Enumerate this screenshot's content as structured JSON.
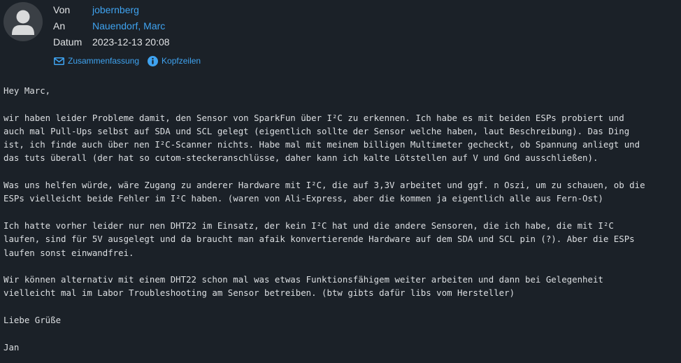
{
  "header": {
    "from_label": "Von",
    "from_value": "jobernberg",
    "to_label": "An",
    "to_value": "Nauendorf, Marc",
    "date_label": "Datum",
    "date_value": "2023-12-13 20:08"
  },
  "actions": {
    "summary_label": "Zusammenfassung",
    "headers_label": "Kopfzeilen"
  },
  "icons": {
    "avatar": "person-silhouette-icon",
    "summary": "envelope-icon",
    "headers": "info-icon"
  },
  "colors": {
    "background": "#1b2128",
    "link": "#3fa3f0",
    "text": "#e2e4e6"
  },
  "message": {
    "greeting": "Hey Marc,",
    "paragraph_1": "wir haben leider Probleme damit, den Sensor von SparkFun über I²C zu erkennen. Ich habe es mit beiden ESPs probiert und\nauch mal Pull-Ups selbst auf SDA und SCL gelegt (eigentlich sollte der Sensor welche haben, laut Beschreibung). Das Ding\nist, ich finde auch über nen I²C-Scanner nichts. Habe mal mit meinem billigen Multimeter gecheckt, ob Spannung anliegt und\ndas tuts überall (der hat so cutom-steckeranschlüsse, daher kann ich kalte Lötstellen auf V und Gnd ausschließen).",
    "paragraph_2": "Was uns helfen würde, wäre Zugang zu anderer Hardware mit I²C, die auf 3,3V arbeitet und ggf. n Oszi, um zu schauen, ob die\nESPs vielleicht beide Fehler im I²C haben. (waren von Ali-Express, aber die kommen ja eigentlich alle aus Fern-Ost)",
    "paragraph_3": "Ich hatte vorher leider nur nen DHT22 im Einsatz, der kein I²C hat und die andere Sensoren, die ich habe, die mit I²C\nlaufen, sind für 5V ausgelegt und da braucht man afaik konvertierende Hardware auf dem SDA und SCL pin (?). Aber die ESPs\nlaufen sonst einwandfrei.",
    "paragraph_4": "Wir können alternativ mit einem DHT22 schon mal was etwas Funktionsfähigem weiter arbeiten und dann bei Gelegenheit\nvielleicht mal im Labor Troubleshooting am Sensor betreiben. (btw gibts dafür libs vom Hersteller)",
    "closing": "Liebe Grüße",
    "signature": "Jan"
  }
}
